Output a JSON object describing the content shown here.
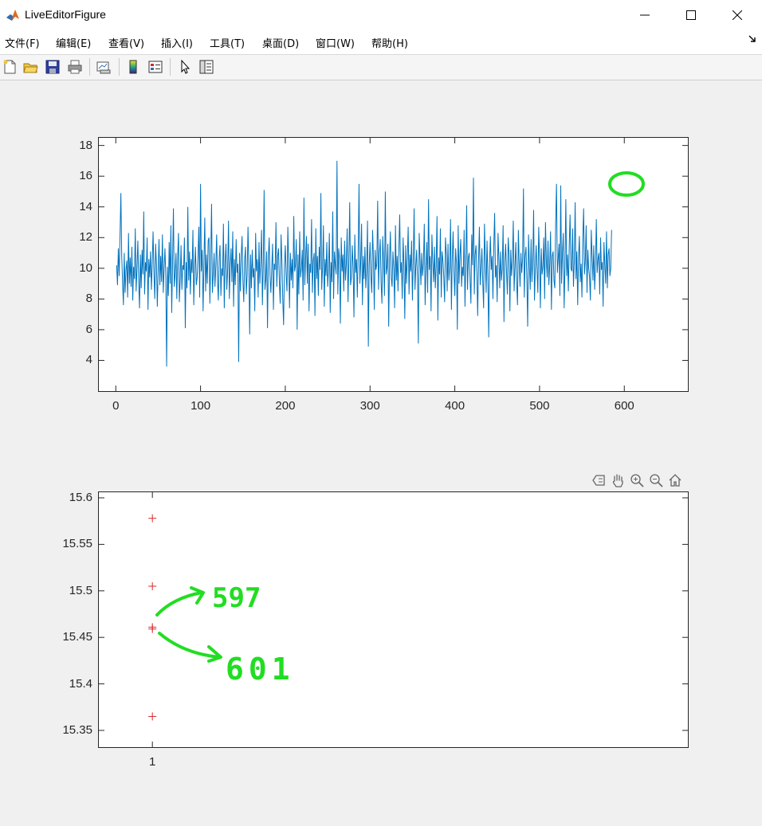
{
  "window": {
    "title": "LiveEditorFigure",
    "controls": [
      "minimize",
      "maximize",
      "close"
    ]
  },
  "menu": {
    "items": [
      "文件(F)",
      "编辑(E)",
      "查看(V)",
      "插入(I)",
      "工具(T)",
      "桌面(D)",
      "窗口(W)",
      "帮助(H)"
    ]
  },
  "toolbar": {
    "icons": [
      "new-figure-icon",
      "open-file-icon",
      "save-icon",
      "print-icon",
      "link-plot-icon",
      "insert-colorbar-icon",
      "insert-legend-icon",
      "edit-plot-arrow-icon",
      "property-inspector-icon"
    ]
  },
  "axes_toolbar": {
    "icons": [
      "data-tips-icon",
      "pan-hand-icon",
      "zoom-in-icon",
      "zoom-out-icon",
      "restore-view-home-icon"
    ]
  },
  "colors": {
    "line": "#0072bd",
    "marker": "#d62728",
    "annotation": "#22dd22"
  },
  "annotations": {
    "label_597": "597",
    "label_601": "601"
  },
  "chart_data": [
    {
      "type": "line",
      "title": "",
      "xlabel": "",
      "ylabel": "",
      "xlim": [
        -20,
        675
      ],
      "ylim": [
        2.0,
        18.5
      ],
      "xticks": [
        0,
        100,
        200,
        300,
        400,
        500,
        600
      ],
      "yticks": [
        4,
        6,
        8,
        10,
        12,
        14,
        16,
        18
      ],
      "grid": false,
      "series": [
        {
          "x_start": 1,
          "x_step": 1,
          "values": [
            10.2,
            8.9,
            11.3,
            9.5,
            12.1,
            14.9,
            10.8,
            9.1,
            7.6,
            11.0,
            8.4,
            9.9,
            10.5,
            8.1,
            12.3,
            9.0,
            10.7,
            8.8,
            11.4,
            7.9,
            10.1,
            9.3,
            12.6,
            8.5,
            10.0,
            11.8,
            9.2,
            7.4,
            10.9,
            8.7,
            11.2,
            9.6,
            13.7,
            8.3,
            10.4,
            9.8,
            12.0,
            7.3,
            10.6,
            9.4,
            11.1,
            8.6,
            10.3,
            12.4,
            9.7,
            8.0,
            11.6,
            10.2,
            7.5,
            9.9,
            11.9,
            8.9,
            10.8,
            9.1,
            12.2,
            8.4,
            10.0,
            11.3,
            9.5,
            3.6,
            10.1,
            8.2,
            11.7,
            9.0,
            12.8,
            7.1,
            10.5,
            13.9,
            8.8,
            9.6,
            11.0,
            8.0,
            10.7,
            12.3,
            7.8,
            9.3,
            11.5,
            8.6,
            10.2,
            9.9,
            12.0,
            6.1,
            10.4,
            8.7,
            14.0,
            9.2,
            11.1,
            8.3,
            10.6,
            9.7,
            12.5,
            7.6,
            10.0,
            11.4,
            8.9,
            9.4,
            10.8,
            12.7,
            8.1,
            15.5,
            9.8,
            11.2,
            7.2,
            10.3,
            13.3,
            8.5,
            10.9,
            9.0,
            11.8,
            12.0,
            7.7,
            10.5,
            14.2,
            8.4,
            9.6,
            11.0,
            8.8,
            10.1,
            12.2,
            9.3,
            7.9,
            10.7,
            11.5,
            8.2,
            10.0,
            9.5,
            12.9,
            7.4,
            10.4,
            11.6,
            8.6,
            9.9,
            13.1,
            8.0,
            10.2,
            11.3,
            9.1,
            12.4,
            7.5,
            10.6,
            8.9,
            11.9,
            9.7,
            10.3,
            3.9,
            11.0,
            8.5,
            10.8,
            12.1,
            9.2,
            7.8,
            10.5,
            11.4,
            8.3,
            9.6,
            12.7,
            10.1,
            5.7,
            10.9,
            8.7,
            11.2,
            9.4,
            10.0,
            7.2,
            12.3,
            9.8,
            10.6,
            8.1,
            11.7,
            9.0,
            10.4,
            12.5,
            7.6,
            10.2,
            15.1,
            8.6,
            9.3,
            11.1,
            6.1,
            10.7,
            12.0,
            9.5,
            8.4,
            10.0,
            11.6,
            7.3,
            10.3,
            9.9,
            13.0,
            8.8,
            10.8,
            11.3,
            9.1,
            7.7,
            12.2,
            10.5,
            8.0,
            6.3,
            10.1,
            11.5,
            9.6,
            8.5,
            12.7,
            10.4,
            7.4,
            11.0,
            9.2,
            10.6,
            8.7,
            13.4,
            9.8,
            10.2,
            11.9,
            6.0,
            10.9,
            8.3,
            12.4,
            9.4,
            10.0,
            11.2,
            7.9,
            14.6,
            8.9,
            10.7,
            12.1,
            9.0,
            11.6,
            7.2,
            10.3,
            9.7,
            13.2,
            8.4,
            10.5,
            11.0,
            6.9,
            12.6,
            9.3,
            10.8,
            8.2,
            11.4,
            9.9,
            14.9,
            8.6,
            10.1,
            12.8,
            7.5,
            10.6,
            9.5,
            11.7,
            8.8,
            10.0,
            12.3,
            7.1,
            10.4,
            9.1,
            13.7,
            8.0,
            11.1,
            10.2,
            9.6,
            17.0,
            8.3,
            11.3,
            10.7,
            6.4,
            12.0,
            9.8,
            10.9,
            8.5,
            11.8,
            9.2,
            10.3,
            12.6,
            7.8,
            10.5,
            14.3,
            8.9,
            9.4,
            11.5,
            10.1,
            6.8,
            12.2,
            9.7,
            10.6,
            8.1,
            11.0,
            15.5,
            9.0,
            10.4,
            12.9,
            7.6,
            10.8,
            9.3,
            11.4,
            8.7,
            10.0,
            13.1,
            4.9,
            10.2,
            11.7,
            9.5,
            8.4,
            12.5,
            10.7,
            7.3,
            11.2,
            9.9,
            10.3,
            14.4,
            8.6,
            10.9,
            11.9,
            9.1,
            7.7,
            12.1,
            10.5,
            8.2,
            15.0,
            9.6,
            10.1,
            11.6,
            6.2,
            10.6,
            12.4,
            9.4,
            8.8,
            11.1,
            10.0,
            7.4,
            12.8,
            9.2,
            10.8,
            8.5,
            11.3,
            13.5,
            9.7,
            10.4,
            8.0,
            12.0,
            10.2,
            6.7,
            11.5,
            9.0,
            10.7,
            12.7,
            8.3,
            10.9,
            9.8,
            11.8,
            7.9,
            10.5,
            13.9,
            8.6,
            10.1,
            11.2,
            9.3,
            5.1,
            12.3,
            10.6,
            8.9,
            11.0,
            9.5,
            10.3,
            12.9,
            7.6,
            10.0,
            11.7,
            8.4,
            14.5,
            9.9,
            10.8,
            7.2,
            12.2,
            10.4,
            9.1,
            11.4,
            8.7,
            10.2,
            13.4,
            6.6,
            10.7,
            9.6,
            12.6,
            8.1,
            11.1,
            10.5,
            9.4,
            7.8,
            12.0,
            10.9,
            8.5,
            11.6,
            9.2,
            10.0,
            13.2,
            7.3,
            10.6,
            12.4,
            9.8,
            8.2,
            11.3,
            10.3,
            6.0,
            12.8,
            9.0,
            10.8,
            11.9,
            8.8,
            10.1,
            9.5,
            12.5,
            7.5,
            10.4,
            14.1,
            8.6,
            10.7,
            11.0,
            9.3,
            7.7,
            12.2,
            10.2,
            15.9,
            8.3,
            10.9,
            11.5,
            9.7,
            6.9,
            10.5,
            12.7,
            8.9,
            10.0,
            11.3,
            9.1,
            7.4,
            12.9,
            10.6,
            8.4,
            11.8,
            9.6,
            5.5,
            10.3,
            12.1,
            9.9,
            10.8,
            8.0,
            11.4,
            13.6,
            9.4,
            10.2,
            7.8,
            12.3,
            10.7,
            8.7,
            11.1,
            9.2,
            10.0,
            12.8,
            6.5,
            10.4,
            11.6,
            9.8,
            8.3,
            12.0,
            10.9,
            7.2,
            11.2,
            9.5,
            10.5,
            13.1,
            8.5,
            10.1,
            11.7,
            9.0,
            7.6,
            12.5,
            10.3,
            8.8,
            11.0,
            9.7,
            10.6,
            15.2,
            8.1,
            10.8,
            11.4,
            9.3,
            6.2,
            12.2,
            10.2,
            8.6,
            11.9,
            9.1,
            10.4,
            13.8,
            7.9,
            10.0,
            11.5,
            9.9,
            8.4,
            12.7,
            10.7,
            7.4,
            11.3,
            9.6,
            10.1,
            12.0,
            8.0,
            13.0,
            10.5,
            9.4,
            11.8,
            8.9,
            10.3,
            12.4,
            7.3,
            10.8,
            11.1,
            9.2,
            8.7,
            12.9,
            15.5,
            9.7,
            10.6,
            11.6,
            8.2,
            15.4,
            9.0,
            11.0,
            12.3,
            7.4,
            10.2,
            14.5,
            9.5,
            10.9,
            8.5,
            11.4,
            13.5,
            10.0,
            9.8,
            12.6,
            8.8,
            10.4,
            14.3,
            9.3,
            11.1,
            7.6,
            10.7,
            12.1,
            9.1,
            10.3,
            8.1,
            11.9,
            13.9,
            9.6,
            10.5,
            12.8,
            8.4,
            11.2,
            10.0,
            9.4,
            7.9,
            12.5,
            10.8,
            9.2,
            11.5,
            8.6,
            10.1,
            13.2,
            9.7,
            10.6,
            11.0,
            8.3,
            12.0,
            9.9,
            10.4,
            7.5,
            11.7,
            10.2,
            9.0,
            12.4,
            8.7,
            10.9,
            11.3,
            9.5,
            10.0,
            12.5
          ]
        }
      ]
    },
    {
      "type": "scatter",
      "title": "",
      "xlabel": "",
      "ylabel": "",
      "marker": "+",
      "xlim": [
        0.5,
        6.0
      ],
      "ylim": [
        15.332,
        15.606
      ],
      "xticks": [
        1
      ],
      "yticks": [
        15.35,
        15.4,
        15.45,
        15.5,
        15.55,
        15.6
      ],
      "ytick_labels": [
        "15.35",
        "15.4",
        "15.45",
        "15.5",
        "15.55",
        "15.6"
      ],
      "grid": false,
      "points": [
        {
          "x": 1,
          "y": 15.578
        },
        {
          "x": 1,
          "y": 15.505
        },
        {
          "x": 1,
          "y": 15.461
        },
        {
          "x": 1,
          "y": 15.459
        },
        {
          "x": 1,
          "y": 15.365
        }
      ]
    }
  ]
}
